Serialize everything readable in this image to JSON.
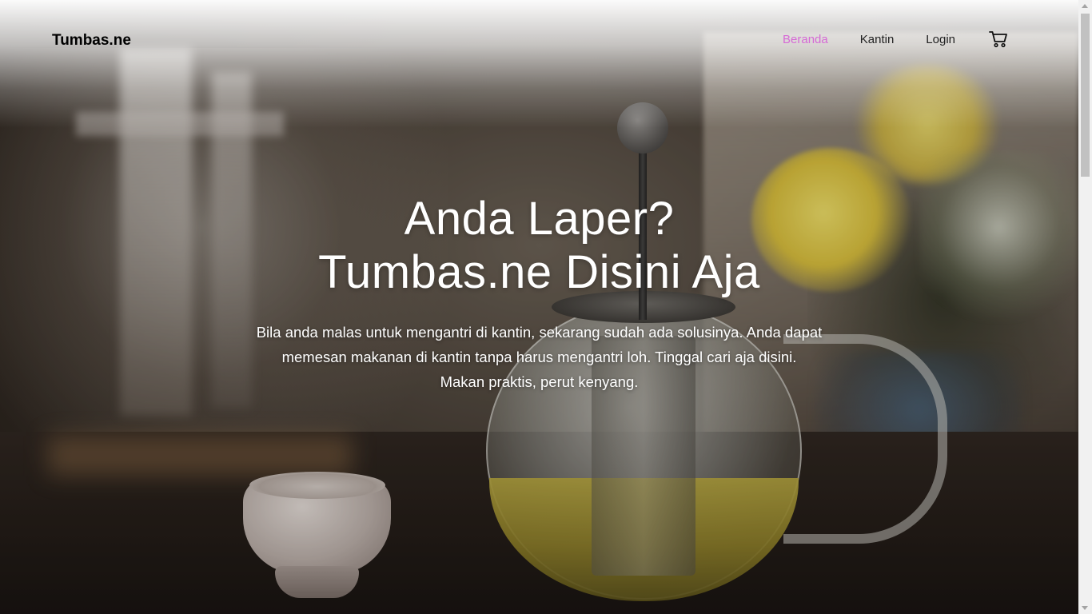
{
  "navbar": {
    "brand": "Tumbas.ne",
    "links": [
      {
        "label": "Beranda",
        "active": true
      },
      {
        "label": "Kantin",
        "active": false
      },
      {
        "label": "Login",
        "active": false
      }
    ],
    "cart_icon": "cart-icon"
  },
  "hero": {
    "headline_line1": "Anda Laper?",
    "headline_line2": "Tumbas.ne Disini Aja",
    "lead_line1": "Bila anda malas untuk mengantri di kantin, sekarang sudah ada solusinya. Anda dapat",
    "lead_line2": "memesan makanan di kantin tanpa harus mengantri loh. Tinggal cari aja disini.",
    "lead_line3": "Makan praktis, perut kenyang.",
    "background_image": "teapot-and-cup-photo"
  },
  "colors": {
    "active_link": "#d66ad6",
    "brand_text": "#000000",
    "hero_text": "#ffffff"
  }
}
